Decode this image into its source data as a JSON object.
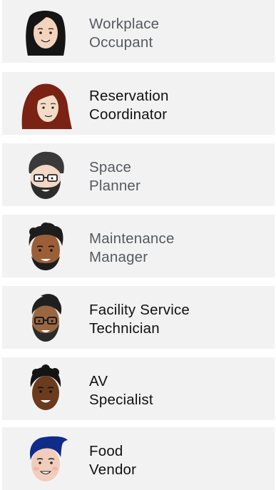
{
  "personas": [
    {
      "line1": "Workplace",
      "line2": "Occupant",
      "avatar_icon": "woman-black-hair-avatar-icon",
      "selected": false
    },
    {
      "line1": "Reservation",
      "line2": "Coordinator",
      "avatar_icon": "woman-red-hair-avatar-icon",
      "selected": true
    },
    {
      "line1": "Space",
      "line2": "Planner",
      "avatar_icon": "man-glasses-beard-avatar-icon",
      "selected": false
    },
    {
      "line1": "Maintenance",
      "line2": "Manager",
      "avatar_icon": "man-curly-hair-avatar-icon",
      "selected": false
    },
    {
      "line1": "Facility Service",
      "line2": "Technician",
      "avatar_icon": "man-glasses-beard-pompadour-avatar-icon",
      "selected": true
    },
    {
      "line1": "AV",
      "line2": "Specialist",
      "avatar_icon": "man-dark-skin-avatar-icon",
      "selected": true
    },
    {
      "line1": "Food",
      "line2": "Vendor",
      "avatar_icon": "man-blue-hair-avatar-icon",
      "selected": true
    }
  ],
  "colors": {
    "card_background": "#f2f2f2",
    "muted_text": "#555a60",
    "strong_text": "#111111"
  }
}
